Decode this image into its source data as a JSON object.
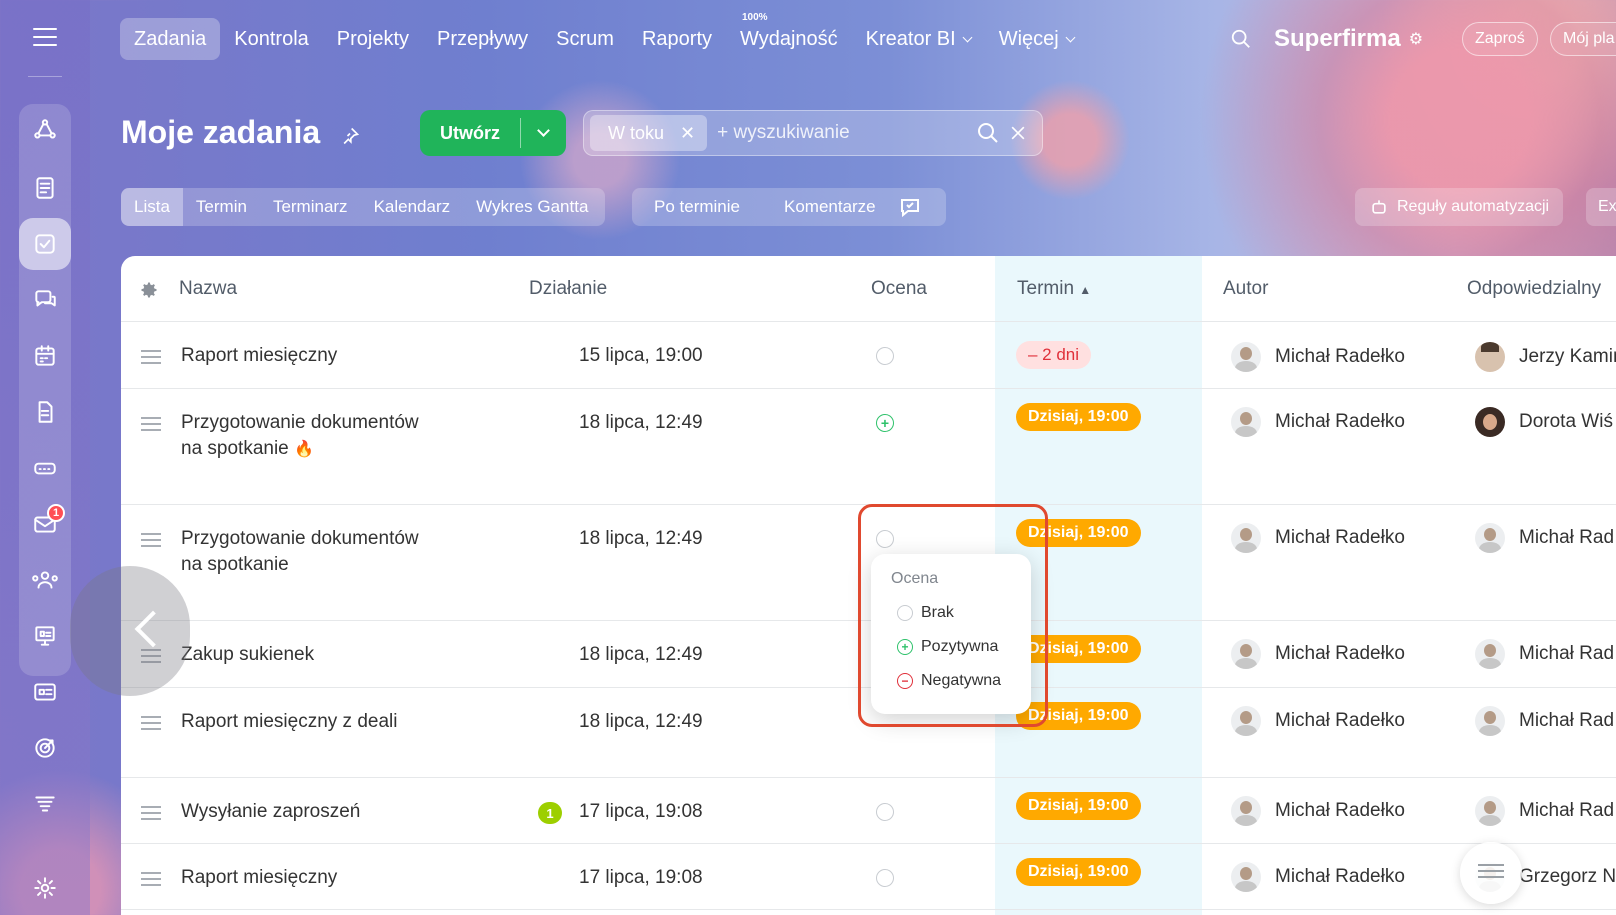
{
  "topnav": {
    "items": [
      {
        "label": "Zadania",
        "active": true
      },
      {
        "label": "Kontrola"
      },
      {
        "label": "Projekty"
      },
      {
        "label": "Przepływy"
      },
      {
        "label": "Scrum"
      },
      {
        "label": "Raporty"
      },
      {
        "label": "Wydajność",
        "superscript": "100%"
      },
      {
        "label": "Kreator BI",
        "dropdown": true
      },
      {
        "label": "Więcej",
        "dropdown": true
      }
    ],
    "brand": "Superfirma",
    "invite_label": "Zaproś",
    "plan_label": "Mój pla"
  },
  "sidebar": {
    "icons": [
      "network-icon",
      "feed-icon",
      "tasks-icon",
      "chat-icon",
      "calendar-icon",
      "document-icon",
      "drive-icon",
      "mail-icon",
      "contacts-icon",
      "presentation-icon",
      "id-card-icon",
      "target-icon",
      "filter-icon",
      "settings-icon"
    ],
    "mail_badge": "1"
  },
  "page": {
    "title": "Moje zadania",
    "create_label": "Utwórz",
    "filter_tag": "W toku",
    "search_placeholder": "+ wyszukiwanie"
  },
  "view_tabs": [
    "Lista",
    "Termin",
    "Terminarz",
    "Kalendarz",
    "Wykres Gantta"
  ],
  "quick_filters": [
    "Po terminie",
    "Komentarze"
  ],
  "automation_label": "Reguły automatyzacji",
  "automation_label2": "Ex",
  "table": {
    "headers": {
      "name": "Nazwa",
      "action": "Działanie",
      "rating": "Ocena",
      "deadline": "Termin",
      "author": "Autor",
      "responsible": "Odpowiedzialny"
    },
    "rows": [
      {
        "name": "Raport miesięczny",
        "action": "15 lipca, 19:00",
        "rating": "none",
        "deadline": "– 2 dni",
        "deadline_type": "overdue",
        "author": "Michał Radełko",
        "responsible": "Jerzy Kamiń"
      },
      {
        "name": "Przygotowanie dokumentów na spotkanie",
        "hot": true,
        "action": "18 lipca, 12:49",
        "rating": "positive",
        "deadline": "Dzisiaj, 19:00",
        "deadline_type": "today",
        "author": "Michał Radełko",
        "responsible": "Dorota Wiś"
      },
      {
        "name": "Przygotowanie dokumentów na spotkanie",
        "action": "18 lipca, 12:49",
        "rating": "none",
        "deadline": "Dzisiaj, 19:00",
        "deadline_type": "today",
        "author": "Michał Radełko",
        "responsible": "Michał Rad"
      },
      {
        "name": "Zakup sukienek",
        "action": "18 lipca, 12:49",
        "rating": "none",
        "deadline": "Dzisiaj, 19:00",
        "deadline_type": "today",
        "author": "Michał Radełko",
        "responsible": "Michał Rad"
      },
      {
        "name": "Raport miesięczny z deali",
        "action": "18 lipca, 12:49",
        "rating": "none",
        "deadline": "Dzisiaj, 19:00",
        "deadline_type": "today",
        "author": "Michał Radełko",
        "responsible": "Michał Rad"
      },
      {
        "name": "Wysyłanie zaproszeń",
        "counter": "1",
        "action": "17 lipca, 19:08",
        "rating": "none",
        "deadline": "Dzisiaj, 19:00",
        "deadline_type": "today",
        "author": "Michał Radełko",
        "responsible": "Michał Rad"
      },
      {
        "name": "Raport miesięczny",
        "action": "17 lipca, 19:08",
        "rating": "none",
        "deadline": "Dzisiaj, 19:00",
        "deadline_type": "today",
        "author": "Michał Radełko",
        "responsible": "Grzegorz N"
      }
    ]
  },
  "rating_popup": {
    "title": "Ocena",
    "options": [
      "Brak",
      "Pozytywna",
      "Negatywna"
    ]
  },
  "colors": {
    "create_button": "#20b45a",
    "deadline_today": "#ffa900",
    "deadline_overdue_text": "#e0303a",
    "highlight": "#e0492f",
    "termin_column": "#eaf8fc"
  }
}
